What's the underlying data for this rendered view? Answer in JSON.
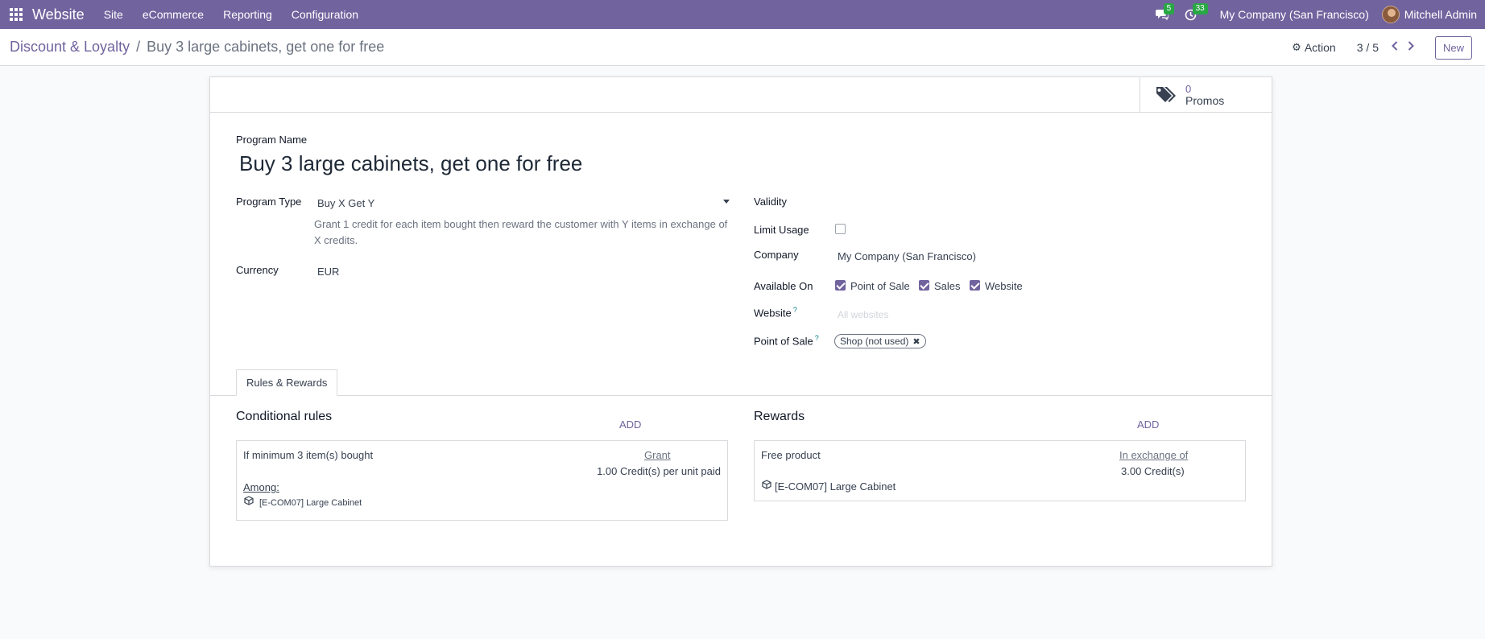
{
  "navbar": {
    "brand": "Website",
    "menu": [
      "Site",
      "eCommerce",
      "Reporting",
      "Configuration"
    ],
    "messages_count": "5",
    "activities_count": "33",
    "company": "My Company (San Francisco)",
    "user": "Mitchell Admin"
  },
  "control_panel": {
    "breadcrumb_parent": "Discount & Loyalty",
    "breadcrumb_separator": "/",
    "breadcrumb_current": "Buy 3 large cabinets, get one for free",
    "action_label": "Action",
    "pager": "3 / 5",
    "new_label": "New"
  },
  "smart_button": {
    "value": "0",
    "label": "Promos",
    "icon": "tags-icon"
  },
  "form": {
    "program_name_label": "Program Name",
    "program_name": "Buy 3 large cabinets, get one for free",
    "program_type_label": "Program Type",
    "program_type_value": "Buy X Get Y",
    "program_type_help": "Grant 1 credit for each item bought then reward the customer with Y items in exchange of X credits.",
    "currency_label": "Currency",
    "currency_value": "EUR",
    "validity_label": "Validity",
    "limit_usage_label": "Limit Usage",
    "company_label": "Company",
    "company_value": "My Company (San Francisco)",
    "available_on_label": "Available On",
    "available_on": [
      {
        "label": "Point of Sale",
        "checked": true
      },
      {
        "label": "Sales",
        "checked": true
      },
      {
        "label": "Website",
        "checked": true
      }
    ],
    "website_label": "Website",
    "website_placeholder": "All websites",
    "pos_label": "Point of Sale",
    "pos_tag": "Shop (not used)",
    "help_mark": "?"
  },
  "tabs": {
    "rules_rewards": "Rules & Rewards"
  },
  "rules": {
    "title": "Conditional rules",
    "add": "ADD",
    "condition": "If minimum 3 item(s) bought",
    "grant_label": "Grant",
    "grant_value": "1.00 Credit(s) per unit paid",
    "among_label": "Among:",
    "product": "[E-COM07] Large Cabinet"
  },
  "rewards": {
    "title": "Rewards",
    "add": "ADD",
    "reward_type": "Free product",
    "exchange_label": "In exchange of",
    "exchange_value": "3.00 Credit(s)",
    "product": "[E-COM07] Large Cabinet"
  },
  "colors": {
    "brand": "#71639e",
    "badge": "#28a745",
    "help": "#017e84"
  }
}
